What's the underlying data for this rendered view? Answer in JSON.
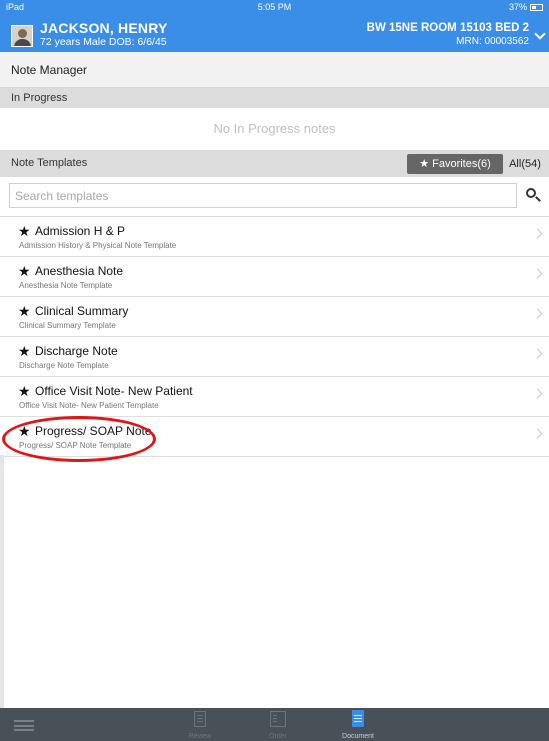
{
  "status_bar": {
    "carrier": "iPad",
    "time": "5:05 PM",
    "battery": "37%"
  },
  "patient": {
    "name": "JACKSON, HENRY",
    "info": "72 years  Male  DOB: 6/6/45",
    "location": "BW 15NE ROOM 15103 BED 2",
    "mrn": "MRN: 00003562"
  },
  "note_manager": {
    "title": "Note Manager"
  },
  "in_progress": {
    "header": "In Progress",
    "empty_message": "No In Progress notes"
  },
  "templates": {
    "header": "Note Templates",
    "favorites_label": "Favorites(6)",
    "all_label": "All(54)",
    "search_placeholder": "Search templates",
    "items": [
      {
        "title": "Admission H & P",
        "subtitle": "Admission History & Physical Note Template"
      },
      {
        "title": "Anesthesia Note",
        "subtitle": "Anesthesia Note Template"
      },
      {
        "title": "Clinical Summary",
        "subtitle": "Clinical Summary Template"
      },
      {
        "title": "Discharge Note",
        "subtitle": "Discharge Note Template"
      },
      {
        "title": "Office Visit Note- New Patient",
        "subtitle": "Office Visit Note- New Patient Template"
      },
      {
        "title": "Progress/ SOAP Note",
        "subtitle": "Progress/ SOAP Note Template"
      }
    ]
  },
  "tabbar": {
    "review_label": "Review",
    "order_label": "Order",
    "document_label": "Document"
  },
  "colors": {
    "header_blue": "#3a8ee8",
    "annotation_red": "#e01515",
    "tabbar_bg": "#4a5058"
  },
  "icons": [
    "menu-icon",
    "review-icon",
    "order-icon",
    "document-icon",
    "search-icon",
    "star-icon",
    "chevron-right-icon"
  ]
}
